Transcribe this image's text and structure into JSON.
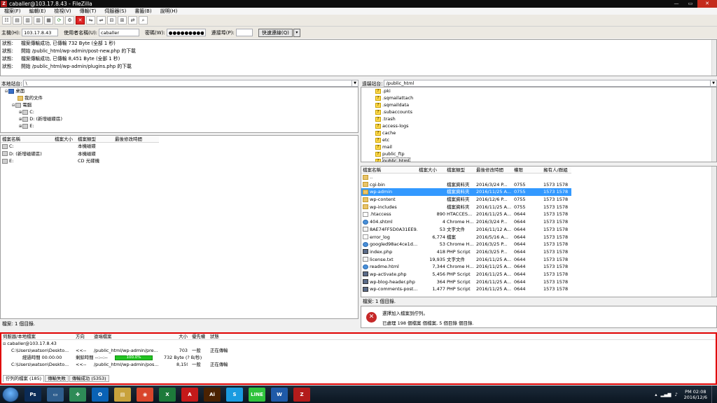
{
  "window": {
    "title": "caballer@103.17.8.43 - FileZilla",
    "app_icon": "Z"
  },
  "menu": [
    "檔案(F)",
    "編輯(E)",
    "檢視(V)",
    "傳輸(T)",
    "伺服器(S)",
    "書籤(B)",
    "說明(H)"
  ],
  "quickconnect": {
    "host_label": "主機(H):",
    "host_value": "103.17.8.43",
    "user_label": "使用者名稱(U):",
    "user_value": "caballer",
    "pass_label": "密碼(W):",
    "pass_value": "●●●●●●●●●",
    "port_label": "連接埠(P):",
    "port_value": "",
    "button_label": "快速連線(Q)",
    "dropdown_icon": "▾"
  },
  "log": [
    {
      "k": "狀態:",
      "v": "檔案傳輸成功, 已傳輸 732 Byte (全部 1 秒)"
    },
    {
      "k": "狀態:",
      "v": "開始 /public_html/wp-admin/post-new.php 的下載"
    },
    {
      "k": "狀態:",
      "v": "檔案傳輸成功, 已傳輸 8,451 Byte (全部 1 秒)"
    },
    {
      "k": "狀態:",
      "v": "開始 /public_html/wp-admin/plugins.php 的下載"
    }
  ],
  "local": {
    "site_label": "本地站台:",
    "site_value": "\\",
    "tree": [
      {
        "label": "桌面",
        "icon": "folder",
        "indent": 1
      },
      {
        "label": "我的文件",
        "icon": "folder",
        "indent": 2
      },
      {
        "label": "電腦",
        "icon": "drive",
        "indent": 2
      },
      {
        "label": "C:",
        "icon": "drive",
        "indent": 3
      },
      {
        "label": "D: (新增磁碟區)",
        "icon": "drive",
        "indent": 3
      },
      {
        "label": "E:",
        "icon": "drive",
        "indent": 3
      }
    ],
    "columns": [
      "檔案名稱",
      "檔案大小",
      "檔案類型",
      "最後修改時間"
    ],
    "files": [
      {
        "name": "C:",
        "size": "",
        "type": "本機磁碟",
        "mod": ""
      },
      {
        "name": "D: (新增磁碟區)",
        "size": "",
        "type": "本機磁碟",
        "mod": ""
      },
      {
        "name": "E:",
        "size": "",
        "type": "CD 光碟機",
        "mod": ""
      }
    ],
    "status": "檔案: 1 個目錄."
  },
  "remote": {
    "site_label": "遠端站台:",
    "site_value": "/public_html",
    "tree": [
      ".pki",
      ".sqmailattach",
      ".sqmaildata",
      ".subaccounts",
      ".trash",
      "access-logs",
      "cache",
      "etc",
      "mail",
      "public_ftp",
      "public_html"
    ],
    "columns": [
      "檔案名稱",
      "檔案大小",
      "檔案類型",
      "最後修改時間",
      "權限",
      "擁有人/群組"
    ],
    "files": [
      {
        "name": "..",
        "size": "",
        "type": "",
        "mod": "",
        "perm": "",
        "owner": "",
        "icon": "folder"
      },
      {
        "name": "cgi-bin",
        "size": "",
        "type": "檔案資料夾",
        "mod": "2016/3/24 P...",
        "perm": "0755",
        "owner": "1573 1578",
        "icon": "folder"
      },
      {
        "name": "wp-admin",
        "size": "",
        "type": "檔案資料夾",
        "mod": "2016/11/25 A...",
        "perm": "0755",
        "owner": "1573 1578",
        "icon": "folder",
        "sel": true
      },
      {
        "name": "wp-content",
        "size": "",
        "type": "檔案資料夾",
        "mod": "2016/12/6 P...",
        "perm": "0755",
        "owner": "1573 1578",
        "icon": "folder"
      },
      {
        "name": "wp-includes",
        "size": "",
        "type": "檔案資料夾",
        "mod": "2016/11/25 A...",
        "perm": "0755",
        "owner": "1573 1578",
        "icon": "folder"
      },
      {
        "name": ".htaccess",
        "size": "890",
        "type": "HTACCES...",
        "mod": "2016/11/25 A...",
        "perm": "0644",
        "owner": "1573 1578",
        "icon": "file"
      },
      {
        "name": "404.shtml",
        "size": "4",
        "type": "Chrome H...",
        "mod": "2016/3/24 P...",
        "perm": "0644",
        "owner": "1573 1578",
        "icon": "html"
      },
      {
        "name": "8AE74FF5D0A31EE9...",
        "size": "53",
        "type": "文字文件",
        "mod": "2016/11/12 A...",
        "perm": "0644",
        "owner": "1573 1578",
        "icon": "txt"
      },
      {
        "name": "error_log",
        "size": "6,774",
        "type": "檔案",
        "mod": "2016/5/16 A...",
        "perm": "0644",
        "owner": "1573 1578",
        "icon": "file"
      },
      {
        "name": "googled98ac4ce1d...",
        "size": "53",
        "type": "Chrome H...",
        "mod": "2016/3/25 P...",
        "perm": "0644",
        "owner": "1573 1578",
        "icon": "html"
      },
      {
        "name": "index.php",
        "size": "418",
        "type": "PHP Script",
        "mod": "2016/3/25 P...",
        "perm": "0644",
        "owner": "1573 1578",
        "icon": "php"
      },
      {
        "name": "license.txt",
        "size": "19,935",
        "type": "文字文件",
        "mod": "2016/11/25 A...",
        "perm": "0644",
        "owner": "1573 1578",
        "icon": "txt"
      },
      {
        "name": "readme.html",
        "size": "7,344",
        "type": "Chrome H...",
        "mod": "2016/11/25 A...",
        "perm": "0644",
        "owner": "1573 1578",
        "icon": "html"
      },
      {
        "name": "wp-activate.php",
        "size": "5,456",
        "type": "PHP Script",
        "mod": "2016/11/25 A...",
        "perm": "0644",
        "owner": "1573 1578",
        "icon": "php"
      },
      {
        "name": "wp-blog-header.php",
        "size": "364",
        "type": "PHP Script",
        "mod": "2016/11/25 A...",
        "perm": "0644",
        "owner": "1573 1578",
        "icon": "php"
      },
      {
        "name": "wp-comments-post....",
        "size": "1,477",
        "type": "PHP Script",
        "mod": "2016/11/25 A...",
        "perm": "0644",
        "owner": "1573 1578",
        "icon": "php"
      }
    ],
    "status": "檔案: 1 個目錄.",
    "error_title": "選擇加入檔案到佇列。",
    "error_detail": "已處理 198 個檔案 個檔案, 5 個目錄 個目錄."
  },
  "queue": {
    "columns": [
      "伺服器/本地檔案",
      "方向",
      "遠端檔案",
      "大小",
      "優先權",
      "狀態"
    ],
    "rows": [
      {
        "local": "caballer@103.17.8.43",
        "dir": "",
        "remote": "",
        "size": "",
        "prio": "",
        "status": ""
      },
      {
        "local": "C:\\Users\\watson\\Deskto...",
        "dir": "<<--",
        "remote": "/public_html/wp-admin/pre...",
        "size": "703",
        "prio": "一般",
        "status": "正在傳輸"
      },
      {
        "local": "經過時間 00:00:00",
        "dir": "剩餘時間 --:--:--",
        "remote": "",
        "size": "732 Byte (? B/秒)",
        "prio": "",
        "status": "",
        "progress": "100.0%"
      },
      {
        "local": "C:\\Users\\watson\\Deskto...",
        "dir": "<<--",
        "remote": "/public_html/wp-admin/pos...",
        "size": "8,159",
        "prio": "一般",
        "status": "正在傳輸"
      }
    ],
    "tabs": [
      "佇列的檔案 (185)",
      "傳輸失敗",
      "傳輸成功 (5353)"
    ]
  },
  "taskbar": {
    "apps": [
      {
        "label": "Ps",
        "color": "#0b2b56"
      },
      {
        "label": "▭",
        "color": "#2f5e8e"
      },
      {
        "label": "✤",
        "color": "#2e8b57"
      },
      {
        "label": "O",
        "color": "#0a62b5"
      },
      {
        "label": "▤",
        "color": "#c8a23c"
      },
      {
        "label": "◉",
        "color": "#d9452b"
      },
      {
        "label": "X",
        "color": "#1d7a3a"
      },
      {
        "label": "A",
        "color": "#c51a1a"
      },
      {
        "label": "Ai",
        "color": "#4b2202"
      },
      {
        "label": "S",
        "color": "#1a9be0"
      },
      {
        "label": "LINE",
        "color": "#2fc23c"
      },
      {
        "label": "W",
        "color": "#1f5aa8"
      },
      {
        "label": "Z",
        "color": "#b31b1b"
      }
    ],
    "time": "PM 02:08",
    "date": "2016/12/6"
  }
}
